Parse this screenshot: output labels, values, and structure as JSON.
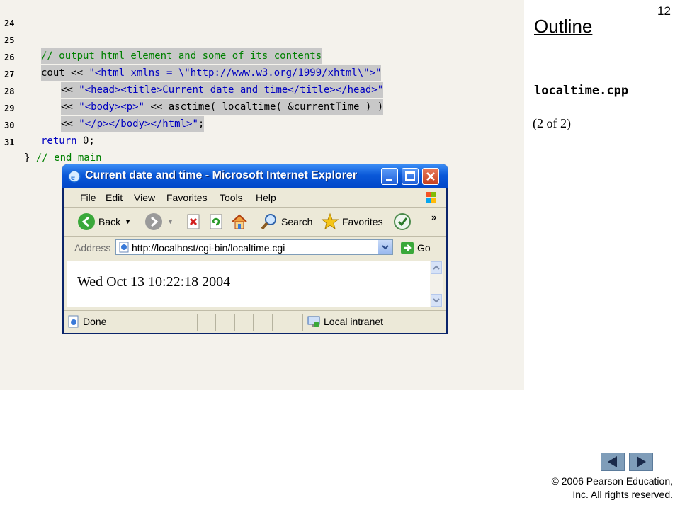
{
  "slide": {
    "number": "12",
    "outline_title": "Outline",
    "filename": "localtime.cpp",
    "part": "(2 of 2)",
    "copyright_line1": "© 2006 Pearson Education,",
    "copyright_line2": "Inc.  All rights reserved."
  },
  "code": {
    "lines": [
      {
        "num": "24",
        "text": ""
      },
      {
        "num": "25",
        "text": "// output html element and some of its contents"
      },
      {
        "num": "26",
        "text_a": "cout << ",
        "text_b": "\"<html xmlns = \\\"http://www.w3.org/1999/xhtml\\\">\""
      },
      {
        "num": "27",
        "text_a": "<< ",
        "text_b": "\"<head><title>Current date and time</title></head>\""
      },
      {
        "num": "28",
        "text_a": "<< ",
        "text_b": "\"<body><p>\"",
        "text_c": " << asctime( localtime( &currentTime ) )"
      },
      {
        "num": "29",
        "text_a": "<< ",
        "text_b": "\"</p></body></html>\"",
        "text_c": ";"
      },
      {
        "num": "30",
        "kw": "return",
        "text": " 0;"
      },
      {
        "num": "31",
        "text_a": "} ",
        "text_b": "// end main"
      }
    ]
  },
  "browser": {
    "title": "Current date and time - Microsoft Internet Explorer",
    "menu": [
      "File",
      "Edit",
      "View",
      "Favorites",
      "Tools",
      "Help"
    ],
    "toolbar": {
      "back": "Back",
      "search": "Search",
      "favorites": "Favorites"
    },
    "address_label": "Address",
    "address_value": "http://localhost/cgi-bin/localtime.cgi",
    "go_label": "Go",
    "page_text": "Wed Oct 13 10:22:18 2004",
    "status_left": "Done",
    "status_zone": "Local intranet"
  }
}
